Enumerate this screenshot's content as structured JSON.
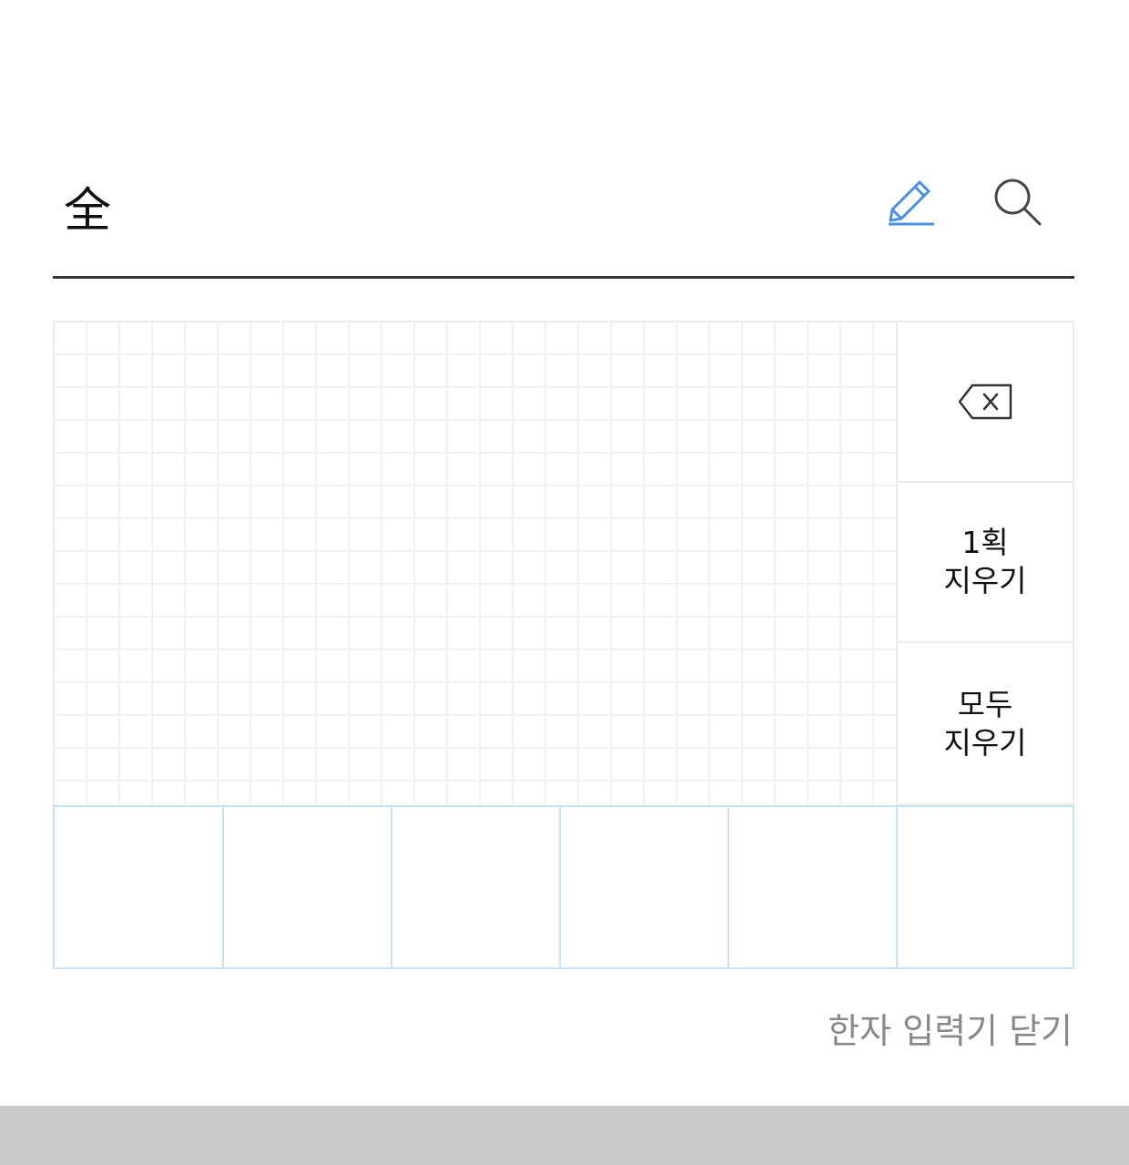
{
  "search": {
    "value": "全",
    "pen_icon": "pencil-icon",
    "search_icon": "search-icon",
    "pen_color": "#4a90e2"
  },
  "pad": {
    "backspace_icon": "backspace-icon",
    "undo_stroke_line1": "1획",
    "undo_stroke_line2": "지우기",
    "clear_all_line1": "모두",
    "clear_all_line2": "지우기",
    "candidates": [
      "",
      "",
      "",
      "",
      "",
      ""
    ]
  },
  "footer": {
    "close_label": "한자 입력기 닫기"
  }
}
